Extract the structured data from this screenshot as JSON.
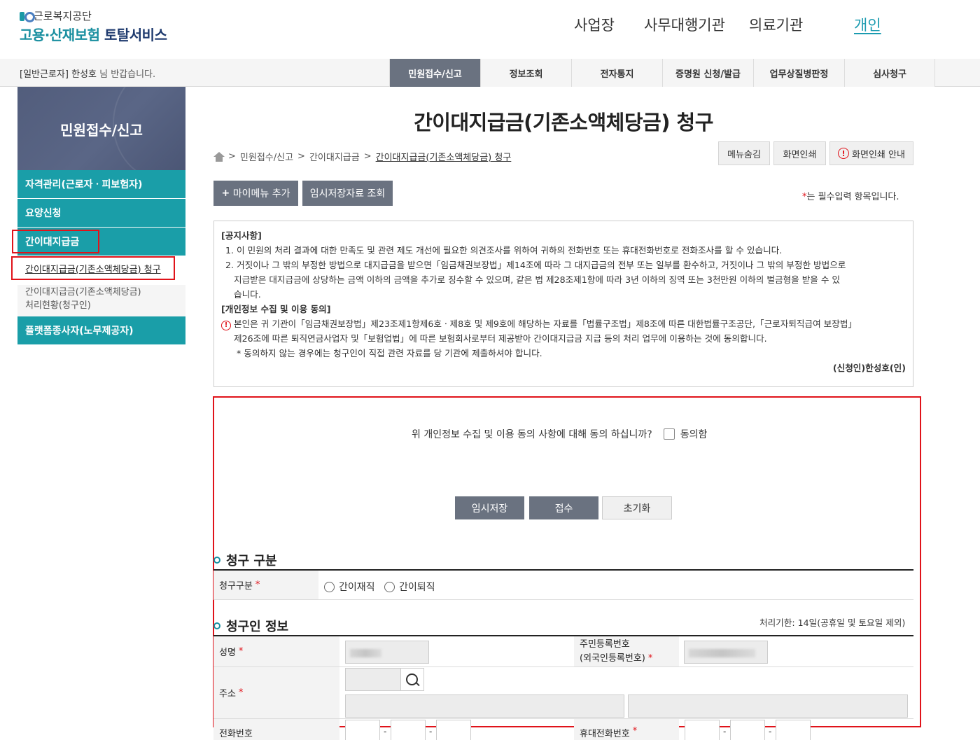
{
  "header": {
    "org_name": "근로복지공단",
    "service_prefix": "고용·산재보험",
    "service_suffix": "토탈서비스",
    "nav": [
      "사업장",
      "사무대행기관",
      "의료기관",
      "개인"
    ]
  },
  "subbar": {
    "welcome_prefix": "[일반근로자] 한성호",
    "welcome_suffix": "님 반갑습니다.",
    "tabs": [
      "민원접수/신고",
      "정보조회",
      "전자통지",
      "증명원 신청/발급",
      "업무상질병판정",
      "심사청구"
    ]
  },
  "sidebar": {
    "title": "민원접수/신고",
    "items": [
      "자격관리(근로자ㆍ피보험자)",
      "요양신청",
      "간이대지급금"
    ],
    "sub_items": [
      "간이대지급금(기존소액체당금) 청구",
      "간이대지급금(기존소액체당금)",
      "처리현황(청구인)"
    ],
    "last_item": "플랫폼종사자(노무제공자)"
  },
  "main": {
    "title": "간이대지급금(기존소액체당금) 청구",
    "breadcrumb": [
      "민원접수/신고",
      "간이대지급금",
      "간이대지급금(기존소액체당금) 청구"
    ],
    "tools": [
      "메뉴숨김",
      "화면인쇄",
      "화면인쇄 안내"
    ],
    "actions": [
      "마이메뉴 추가",
      "임시저장자료 조회"
    ],
    "required_note": "는 필수입력 항목입니다.",
    "notice": {
      "h1": "[공지사항]",
      "l1": "1. 이 민원의 처리 결과에 대한 만족도 및 관련 제도 개선에 필요한 의견조사를 위하여 귀하의 전화번호 또는 휴대전화번호로 전화조사를 할 수 있습니다.",
      "l2a": "2. 거짓이나 그 밖의 부정한 방법으로 대지급금을 받으면「임금채권보장법」제14조에 따라 그 대지급금의 전부 또는 일부를 환수하고, 거짓이나 그 밖의 부정한 방법으로",
      "l2b": "지급받은 대지급금에 상당하는 금액 이하의 금액을 추가로 징수할 수 있으며, 같은 법 제28조제1항에 따라 3년 이하의 징역 또는 3천만원 이하의 벌금형을 받을 수 있",
      "l2c": "습니다.",
      "h2": "[개인정보 수집 및 이용 동의]",
      "p1a": "본인은 귀 기관이「임금채권보장법」제23조제1항제6호ㆍ제8호 및 제9호에 해당하는 자료를「법률구조법」제8조에 따른 대한법률구조공단,「근로자퇴직급여 보장법」",
      "p1b": "제26조에 따른 퇴직연금사업자 및「보험업법」에 따른 보험회사로부터 제공받아 간이대지급금 지급 등의 처리 업무에 이용하는 것에 동의합니다.",
      "p2": "* 동의하지 않는 경우에는 청구인이 직접 관련 자료를 당 기관에 제출하셔야 합니다.",
      "sign": "(신청인)한성호(인)"
    },
    "agree_question": "위 개인정보 수집 및 이용 동의 사항에 대해 동의 하십니까?",
    "agree_label": "동의함",
    "buttons": [
      "임시저장",
      "접수",
      "초기화"
    ],
    "section1": "청구 구분",
    "claim_type_label": "청구구분",
    "claim_options": [
      "간이재직",
      "간이퇴직"
    ],
    "section2": "청구인 정보",
    "deadline": "처리기한: 14일(공휴일 및 토요일 제외)",
    "fields": {
      "name": "성명",
      "rrn1": "주민등록번호",
      "rrn2": "(외국인등록번호)",
      "address": "주소",
      "phone": "전화번호",
      "mobile": "휴대전화번호",
      "dash": "-"
    }
  },
  "colors": {
    "accent": "#1a9ea8",
    "button_dark": "#6a7280",
    "highlight": "#e0131a"
  }
}
